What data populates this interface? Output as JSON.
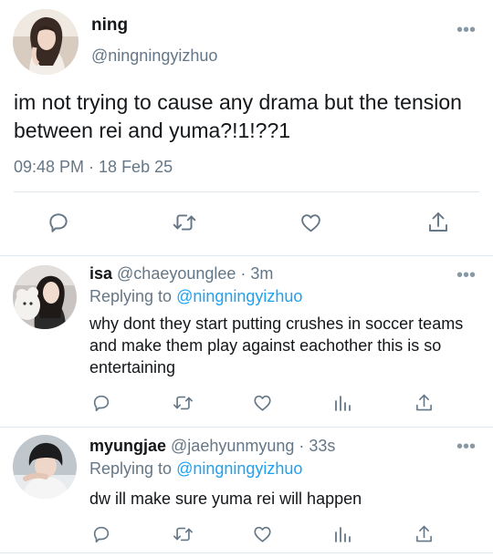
{
  "main_tweet": {
    "display_name": "ning",
    "handle": "@ningningyizhuo",
    "text": "im not trying to cause any drama but the tension between rei and yuma?!1!??1",
    "timestamp": "09:48 PM · 18 Feb 25",
    "actions": [
      "reply-icon",
      "retweet-icon",
      "like-icon",
      "share-icon"
    ]
  },
  "replies": [
    {
      "display_name": "isa",
      "meta": " @chaeyounglee · 3m",
      "replying_prefix": "Replying to ",
      "replying_to": "@ningningyizhuo",
      "text": "why dont they start putting crushes in soccer teams and make them play against eachother this is so entertaining",
      "actions": [
        "reply-icon",
        "retweet-icon",
        "like-icon",
        "analytics-icon",
        "share-icon"
      ]
    },
    {
      "display_name": "myungjae",
      "meta": " @jaehyunmyung · 33s",
      "replying_prefix": "Replying to ",
      "replying_to": "@ningningyizhuo",
      "text": "dw ill make sure yuma rei will happen",
      "actions": [
        "reply-icon",
        "retweet-icon",
        "like-icon",
        "analytics-icon",
        "share-icon"
      ]
    }
  ],
  "more_glyph": "•••",
  "colors": {
    "text": "#14171a",
    "secondary": "#657786",
    "link": "#1da1f2",
    "icon": "#657786",
    "divider": "#e1e8ed"
  }
}
